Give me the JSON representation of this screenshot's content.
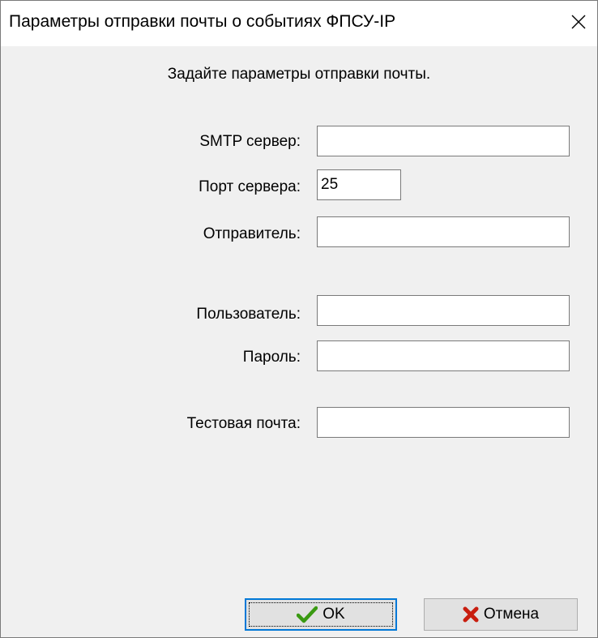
{
  "window": {
    "title": "Параметры отправки почты о событиях ФПСУ-IP",
    "close_icon": "close-icon"
  },
  "dialog": {
    "instruction": "Задайте параметры отправки почты."
  },
  "fields": {
    "smtp_server": {
      "label": "SMTP сервер:",
      "value": ""
    },
    "server_port": {
      "label": "Порт сервера:",
      "value": "25"
    },
    "sender": {
      "label": "Отправитель:",
      "value": ""
    },
    "user": {
      "label": "Пользователь:",
      "value": ""
    },
    "password": {
      "label": "Пароль:",
      "value": ""
    },
    "test_mail": {
      "label": "Тестовая почта:",
      "value": ""
    }
  },
  "buttons": {
    "ok": {
      "label": "OK",
      "icon": "checkmark-icon",
      "color": "#3a9a12"
    },
    "cancel": {
      "label": "Отмена",
      "icon": "cross-icon",
      "color": "#c81e0f"
    }
  },
  "colors": {
    "window_bg": "#f0f0f0",
    "titlebar_bg": "#ffffff",
    "default_button_border": "#0078d7"
  }
}
